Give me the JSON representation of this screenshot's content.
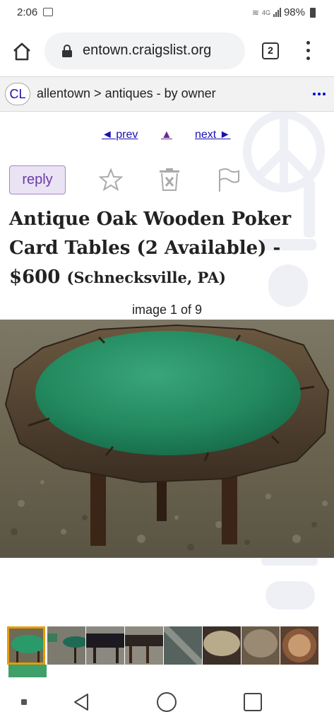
{
  "status_bar": {
    "time": "2:06",
    "network": "4G",
    "battery": "98%"
  },
  "browser": {
    "url": "entown.craigslist.org",
    "tab_count": "2"
  },
  "header": {
    "logo": "CL",
    "breadcrumb": "allentown > antiques - by owner"
  },
  "post_nav": {
    "prev": "◄ prev",
    "up": "▲",
    "next": "next ►"
  },
  "actions": {
    "reply": "reply"
  },
  "posting": {
    "title_line": "Antique Oak Wooden Poker Card Tables (2 Available) -",
    "price": "$600",
    "location": "(Schnecksville, PA)"
  },
  "gallery": {
    "caption": "image 1 of 9",
    "current_image": 1,
    "total_images": 9
  },
  "icons": [
    "home-icon",
    "lock-icon",
    "tabs-icon",
    "overflow-menu-icon",
    "star-icon",
    "trash-icon",
    "flag-icon",
    "back-icon",
    "home-circle-icon",
    "recents-icon"
  ]
}
